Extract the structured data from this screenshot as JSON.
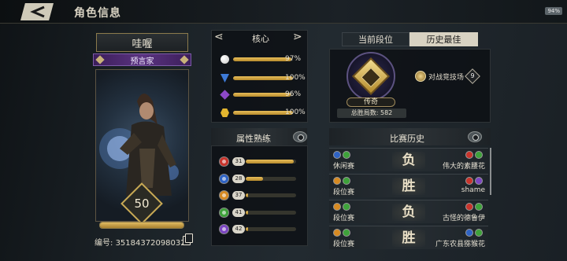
{
  "header": {
    "title": "角色信息",
    "battery": "94%"
  },
  "hero": {
    "name": "哇喔",
    "class": "预言家",
    "level": "50",
    "level_progress": 1.0,
    "serial_label": "编号:",
    "serial": "35184372098032"
  },
  "core": {
    "title": "核心",
    "rows": [
      {
        "icon": "silver-orb-icon",
        "color": "#c9c9c9",
        "value": "97%",
        "progress": 0.97
      },
      {
        "icon": "blue-triangle-icon",
        "color": "#3d7ad8",
        "value": "100%",
        "progress": 1.0
      },
      {
        "icon": "purple-gem-icon",
        "color": "#8c48c8",
        "value": "96%",
        "progress": 0.96
      },
      {
        "icon": "gold-hexagon-icon",
        "color": "#e2b52f",
        "value": "100%",
        "progress": 1.0
      }
    ]
  },
  "mastery": {
    "title": "属性熟练",
    "rows": [
      {
        "icon": "red-element-icon",
        "color": "#c8342c",
        "level": "31",
        "progress": 0.95
      },
      {
        "icon": "blue-element-icon",
        "color": "#2f63c4",
        "level": "28",
        "progress": 0.35
      },
      {
        "icon": "orange-element-icon",
        "color": "#d78a22",
        "level": "37",
        "progress": 0.05
      },
      {
        "icon": "green-element-icon",
        "color": "#3ea23a",
        "level": "41",
        "progress": 0.05
      },
      {
        "icon": "purple-element-icon",
        "color": "#7c46c2",
        "level": "42",
        "progress": 0.05
      }
    ]
  },
  "rank": {
    "tabs": [
      "当前段位",
      "历史最佳"
    ],
    "active_tab": "历史最佳",
    "tier": "传奇",
    "wins_label": "总胜局数:",
    "wins": "582",
    "arena_label": "对战竞技场",
    "arena_count": "9"
  },
  "history": {
    "title": "比赛历史",
    "rows": [
      {
        "mode": "休闲赛",
        "result": "负",
        "opponent": "伟大的素腰花",
        "my_colors": [
          "#2f63c4",
          "#3ea23a"
        ],
        "opp_colors": [
          "#c8342c",
          "#3ea23a"
        ]
      },
      {
        "mode": "段位赛",
        "result": "胜",
        "opponent": "shame",
        "my_colors": [
          "#d78a22",
          "#3ea23a"
        ],
        "opp_colors": [
          "#c8342c",
          "#7c46c2"
        ]
      },
      {
        "mode": "段位赛",
        "result": "负",
        "opponent": "古怪的德鲁伊",
        "my_colors": [
          "#d78a22",
          "#3ea23a"
        ],
        "opp_colors": [
          "#c8342c",
          "#3ea23a"
        ]
      },
      {
        "mode": "段位赛",
        "result": "胜",
        "opponent": "广东农县猕猴花",
        "my_colors": [
          "#d78a22",
          "#3ea23a"
        ],
        "opp_colors": [
          "#2f63c4",
          "#3ea23a"
        ]
      }
    ]
  }
}
